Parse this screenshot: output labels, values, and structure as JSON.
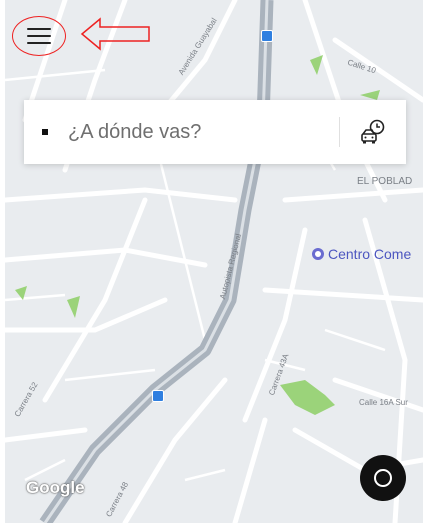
{
  "search": {
    "placeholder": "¿A dónde vas?"
  },
  "map": {
    "street_labels": [
      "Avenida Guayabal",
      "Calle 10",
      "Autopista Regional",
      "Carrera 43A",
      "Carrera 52",
      "Calle 16A Sur",
      "Carrera 48"
    ],
    "area_label": "EL POBLAD",
    "poi_label": "Centro Come",
    "attribution": "Google"
  },
  "colors": {
    "menu_highlight": "#ee2222",
    "poi": "#6a6cd0",
    "highway": "#aab3bd",
    "park": "#9bd37a"
  },
  "icons": {
    "menu": "hamburger-icon",
    "schedule": "car-clock-icon",
    "locate": "locate-me-icon",
    "annotation": "left-arrow-outline"
  }
}
